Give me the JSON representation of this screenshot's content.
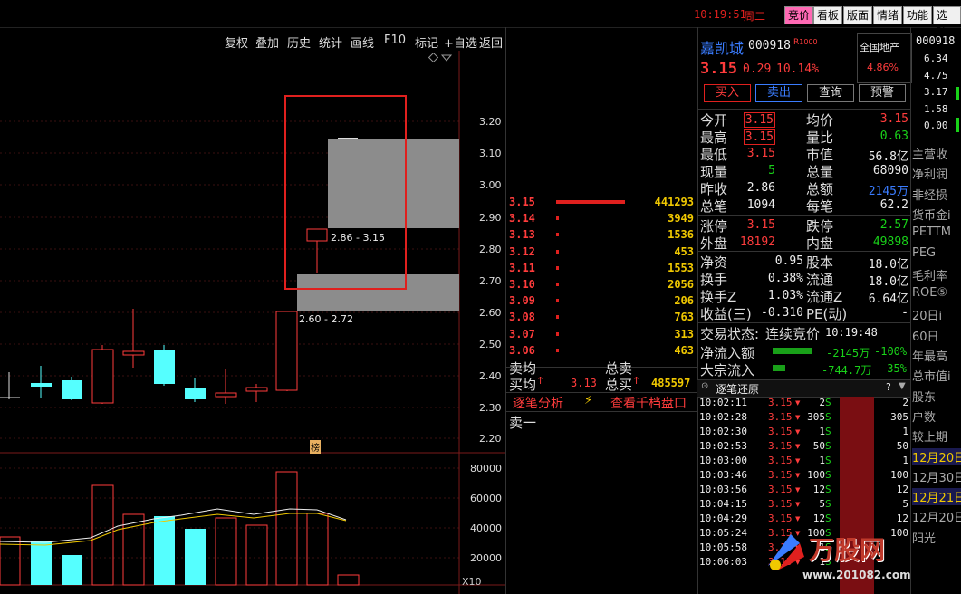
{
  "topbar": {
    "time": "10:19:51",
    "weekday": "周二",
    "buttons": [
      "竞价",
      "看板",
      "版面",
      "情绪",
      "功能",
      "选项"
    ]
  },
  "menu": [
    "复权",
    "叠加",
    "历史",
    "统计",
    "画线",
    "F10",
    "标记",
    "+自选",
    "返回"
  ],
  "price_axis": [
    "3.20",
    "3.10",
    "3.00",
    "2.90",
    "2.80",
    "2.70",
    "2.60",
    "2.50",
    "2.40",
    "2.30",
    "2.20"
  ],
  "vol_axis": [
    "80000",
    "60000",
    "40000",
    "20000"
  ],
  "vol_unit": "X10",
  "annotations": {
    "gap_high": "2.86 - 3.15",
    "gap_low": "2.60 - 2.72",
    "bang": "榜"
  },
  "orderbook": {
    "asks": [
      {
        "price": "3.15",
        "vol": "441293",
        "bar": 1.0
      },
      {
        "price": "3.14",
        "vol": "3949",
        "bar": 0.02
      },
      {
        "price": "3.13",
        "vol": "1536",
        "bar": 0.02
      },
      {
        "price": "3.12",
        "vol": "453",
        "bar": 0.02
      },
      {
        "price": "3.11",
        "vol": "1553",
        "bar": 0.02
      },
      {
        "price": "3.10",
        "vol": "2056",
        "bar": 0.02
      },
      {
        "price": "3.09",
        "vol": "206",
        "bar": 0.02
      },
      {
        "price": "3.08",
        "vol": "763",
        "bar": 0.02
      },
      {
        "price": "3.07",
        "vol": "313",
        "bar": 0.02
      },
      {
        "price": "3.06",
        "vol": "463",
        "bar": 0.02
      }
    ],
    "sell_avg_label": "卖均",
    "total_sell_label": "总卖",
    "buy_avg_label": "买均",
    "buy_avg_arrow": "↑",
    "buy_avg": "3.13",
    "total_buy_label": "总买",
    "total_buy_arrow": "↑",
    "total_buy": "485597",
    "analysis_link": "逐笔分析",
    "depth_link": "查看千档盘口",
    "sell_one": "卖一"
  },
  "stock": {
    "name": "嘉凯城",
    "code": "000918",
    "tag": "R",
    "tag_sup": "1000",
    "price": "3.15",
    "change": "0.29",
    "pct": "10.14%",
    "sector": "全国地产",
    "sector_pct": "4.86%",
    "buttons": [
      "买入",
      "卖出",
      "查询",
      "预警"
    ]
  },
  "quote": {
    "left": [
      {
        "label": "今开",
        "value": "3.15",
        "cls": "red",
        "boxed": true
      },
      {
        "label": "最高",
        "value": "3.15",
        "cls": "red",
        "boxed": true
      },
      {
        "label": "最低",
        "value": "3.15",
        "cls": "red",
        "boxed": false
      },
      {
        "label": "现量",
        "value": "5",
        "cls": "green",
        "boxed": false
      },
      {
        "label": "昨收",
        "value": "2.86",
        "cls": "white",
        "boxed": false
      },
      {
        "label": "总笔",
        "value": "1094",
        "cls": "white",
        "boxed": false
      }
    ],
    "right": [
      {
        "label": "均价",
        "value": "3.15",
        "cls": "red"
      },
      {
        "label": "量比",
        "value": "0.63",
        "cls": "green"
      },
      {
        "label": "市值",
        "value": "56.8亿",
        "cls": "white"
      },
      {
        "label": "总量",
        "value": "68090",
        "cls": "white"
      },
      {
        "label": "总额",
        "value": "2145万",
        "cls": "blue"
      },
      {
        "label": "每笔",
        "value": "62.2",
        "cls": "white"
      }
    ],
    "limit_left": [
      {
        "label": "涨停",
        "value": "3.15",
        "cls": "red"
      },
      {
        "label": "外盘",
        "value": "18192",
        "cls": "red"
      }
    ],
    "limit_right": [
      {
        "label": "跌停",
        "value": "2.57",
        "cls": "green"
      },
      {
        "label": "内盘",
        "value": "49898",
        "cls": "green"
      }
    ],
    "fin_left": [
      {
        "label": "净资",
        "value": "0.95"
      },
      {
        "label": "换手",
        "value": "0.38%"
      },
      {
        "label": "换手Z",
        "value": "1.03%"
      },
      {
        "label": "收益(三)",
        "value": "-0.310"
      }
    ],
    "fin_right": [
      {
        "label": "股本",
        "value": "18.0亿"
      },
      {
        "label": "流通",
        "value": "18.0亿"
      },
      {
        "label": "流通Z",
        "value": "6.64亿"
      },
      {
        "label": "PE(动)",
        "value": "-"
      }
    ],
    "status_label": "交易状态:",
    "status_value": "连续竞价",
    "status_time": "10:19:48",
    "netflow_label": "净流入额",
    "netflow_value": "-2145万",
    "netflow_pct": "-100%",
    "blockflow_label": "大宗流入",
    "blockflow_value": "-744.7万",
    "blockflow_pct": "-35%"
  },
  "ticks_header": "逐笔还原",
  "ticks_help": "?",
  "ticks": [
    {
      "time": "10:02:11",
      "price": "3.15",
      "vol": "2",
      "side": "S",
      "r": "2"
    },
    {
      "time": "10:02:28",
      "price": "3.15",
      "vol": "305",
      "side": "S",
      "r": "305"
    },
    {
      "time": "10:02:30",
      "price": "3.15",
      "vol": "1",
      "side": "S",
      "r": "1"
    },
    {
      "time": "10:02:53",
      "price": "3.15",
      "vol": "50",
      "side": "S",
      "r": "50"
    },
    {
      "time": "10:03:00",
      "price": "3.15",
      "vol": "1",
      "side": "S",
      "r": "1"
    },
    {
      "time": "10:03:46",
      "price": "3.15",
      "vol": "100",
      "side": "S",
      "r": "100"
    },
    {
      "time": "10:03:56",
      "price": "3.15",
      "vol": "12",
      "side": "S",
      "r": "12"
    },
    {
      "time": "10:04:15",
      "price": "3.15",
      "vol": "5",
      "side": "S",
      "r": "5"
    },
    {
      "time": "10:04:29",
      "price": "3.15",
      "vol": "12",
      "side": "S",
      "r": "12"
    },
    {
      "time": "10:05:24",
      "price": "3.15",
      "vol": "100",
      "side": "S",
      "r": "100"
    },
    {
      "time": "10:05:58",
      "price": "3.15",
      "vol": "1",
      "side": "S",
      "r": ""
    },
    {
      "time": "10:06:03",
      "price": "3.15",
      "vol": "1",
      "side": "S",
      "r": ""
    }
  ],
  "far_right": {
    "code": "000918",
    "values": [
      "6.34",
      "4.75",
      "3.17",
      "1.58",
      "0.00"
    ],
    "labels": [
      "主营收",
      "净利润",
      "非经损",
      "货币金i",
      "PETTM",
      "PEG",
      "毛利率",
      "ROE⑤",
      "20日i",
      "60日",
      "年最高",
      "总市值i",
      "股东",
      "户数",
      "较上期",
      "12月20日",
      "12月30日",
      "12月21日",
      "12月20日",
      "阳光"
    ]
  },
  "watermark": {
    "brand": "万股网",
    "url": "www.201082.com"
  },
  "colors": {
    "up": "#ff3c3c",
    "down": "#19d219",
    "accent": "#e0201e",
    "cyan": "#5ff",
    "gray": "#8c8c8c"
  }
}
